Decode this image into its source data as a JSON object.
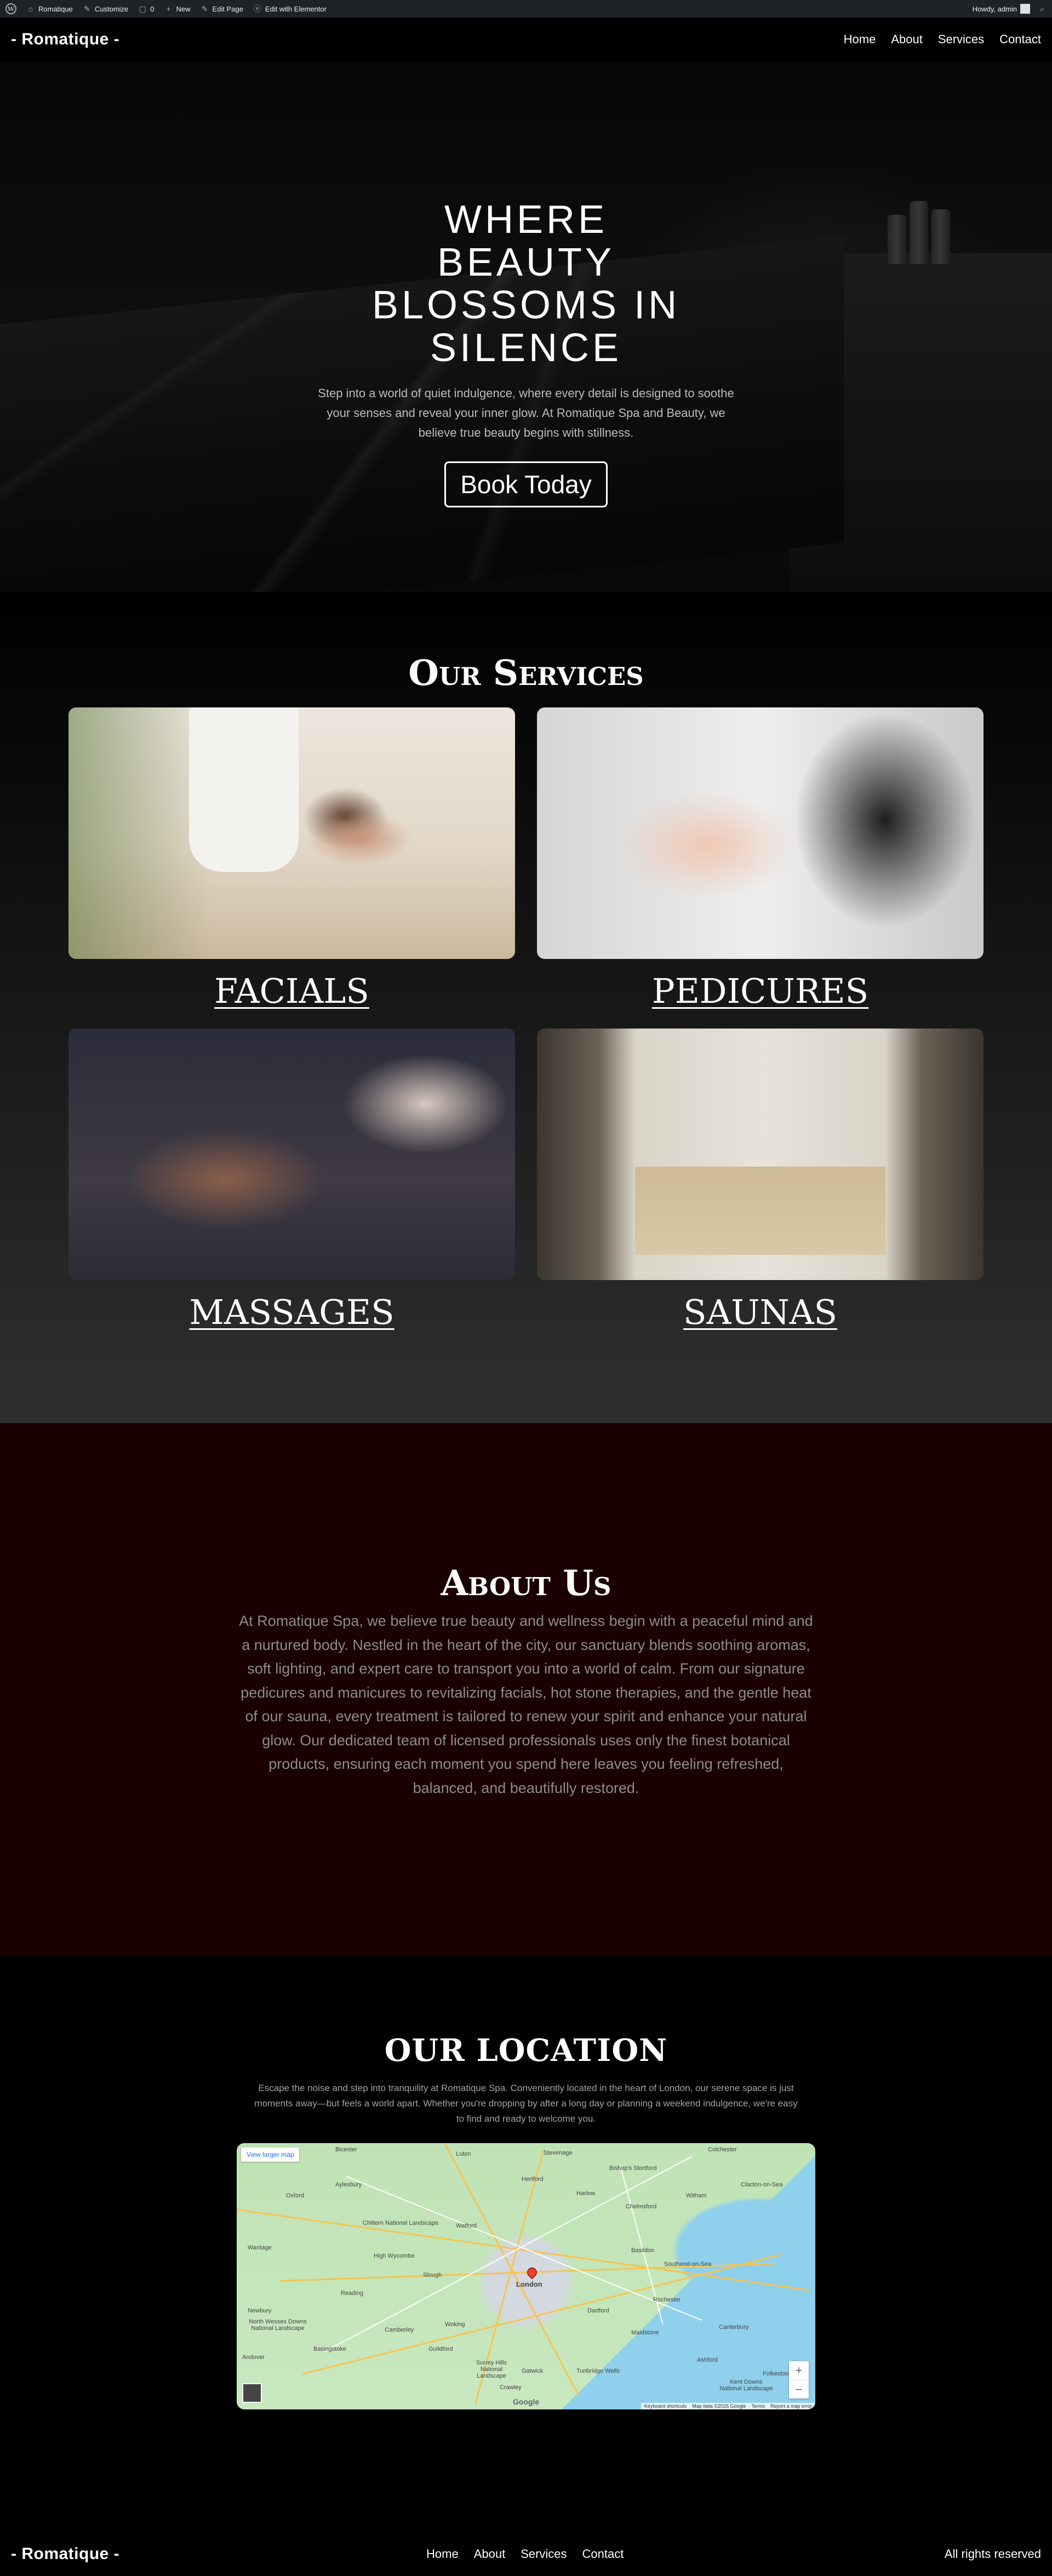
{
  "admin_bar": {
    "site_name": "Romatique",
    "customize": "Customize",
    "comments_count": "0",
    "new": "New",
    "edit_page": "Edit Page",
    "edit_elementor": "Edit with Elementor",
    "howdy": "Howdy, admin"
  },
  "header": {
    "logo": "- Romatique -",
    "nav": [
      "Home",
      "About",
      "Services",
      "Contact"
    ]
  },
  "hero": {
    "title": "WHERE BEAUTY BLOSSOMS IN SILENCE",
    "text": "Step into a world of quiet indulgence, where every detail is designed to soothe your senses and reveal your inner glow. At Romatique Spa and Beauty, we believe true beauty begins with stillness.",
    "button": "Book Today"
  },
  "services": {
    "title": "Our Services",
    "items": [
      {
        "name": "FACIALS"
      },
      {
        "name": "PEDICURES"
      },
      {
        "name": "MASSAGES"
      },
      {
        "name": "SAUNAS"
      }
    ]
  },
  "about": {
    "title": "About Us",
    "text": "At Romatique Spa, we believe true beauty and wellness begin with a peaceful mind and a nurtured body. Nestled in the heart of the city, our sanctuary blends soothing aromas, soft lighting, and expert care to transport you into a world of calm. From our signature pedicures and manicures to revitalizing facials, hot stone therapies, and the gentle heat of our sauna, every treatment is tailored to renew your spirit and enhance your natural glow. Our dedicated team of licensed professionals uses only the finest botanical products, ensuring each moment you spend here leaves you feeling refreshed, balanced, and beautifully restored."
  },
  "location": {
    "title": "OUR LOCATION",
    "text": "Escape the noise and step into tranquility at Romatique Spa. Conveniently located in the heart of London, our serene space is just moments away—but feels a world apart. Whether you're dropping by after a long day or planning a weekend indulgence, we're easy to find and ready to welcome you.",
    "map": {
      "view_larger": "View larger map",
      "zoom_in": "+",
      "zoom_out": "−",
      "google": "Google",
      "attribution": [
        "Keyboard shortcuts",
        "Map data ©2025 Google",
        "Terms",
        "Report a map error"
      ],
      "towns": [
        "Bicester",
        "Luton",
        "Stevenage",
        "Bishop's Stortford",
        "Colchester",
        "Aylesbury",
        "Hertford",
        "Harlow",
        "Witham",
        "Oxford",
        "Chelmsford",
        "Clacton-on-Sea",
        "Watford",
        "Chiltern National Landscape",
        "Wantage",
        "High Wycombe",
        "London",
        "Basildon",
        "Southend-on-Sea",
        "Reading",
        "Slough",
        "Rochester",
        "Newbury",
        "Maidstone",
        "Dartford",
        "Camberley",
        "Guildford",
        "Woking",
        "Crawley",
        "Tunbridge Wells",
        "Canterbury",
        "Ashford",
        "Folkestone",
        "Andover",
        "Basingstoke",
        "Kent Downs National Landscape",
        "Surrey Hills National Landscape",
        "North Wessex Downs National Landscape",
        "Gatwick"
      ]
    }
  },
  "footer": {
    "logo": "- Romatique -",
    "nav": [
      "Home",
      "About",
      "Services",
      "Contact"
    ],
    "copyright": "All rights reserved"
  },
  "colors": {
    "admin_bar": "#1d2327",
    "about_bg": "#1a0000",
    "accent": "#ffffff"
  }
}
